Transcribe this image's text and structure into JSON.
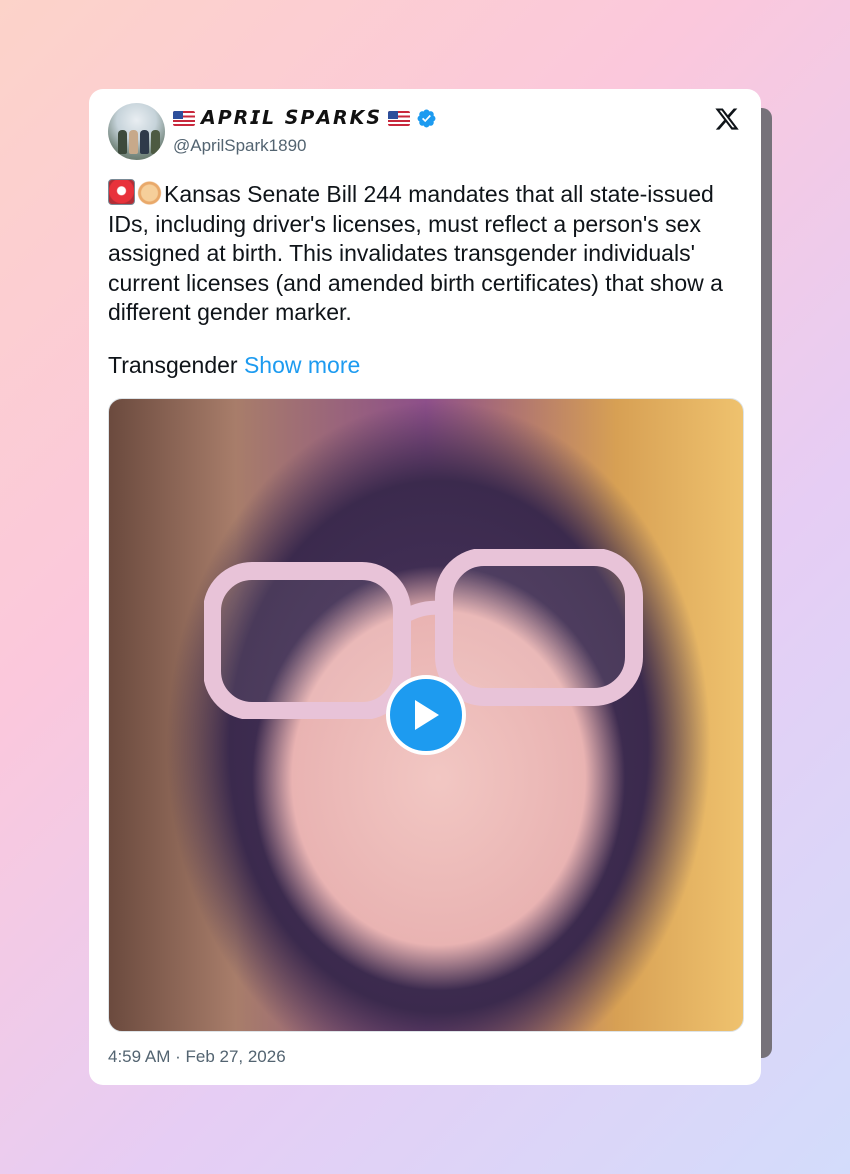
{
  "tweet": {
    "display_name": "𝘼𝙋𝙍𝙄𝙇 𝙎𝙋𝘼𝙍𝙆𝙎",
    "handle": "@AprilSpark1890",
    "text": "Kansas Senate Bill 244 mandates that all state-issued IDs, including driver's licenses, must reflect a person's sex assigned at birth. This invalidates transgender individuals' current licenses (and amended birth certificates) that show a different gender marker.",
    "second_paragraph": "Transgender ",
    "show_more_label": "Show more",
    "timestamp": "4:59 AM · Feb 27, 2026",
    "emojis": [
      "police-light-emoji",
      "clapping-hands-emoji"
    ]
  },
  "icons": {
    "platform": "x-logo-icon",
    "verified": "verified-badge-icon",
    "play": "play-icon",
    "flag": "us-flag-icon"
  },
  "colors": {
    "accent": "#1d9bf0",
    "text": "#0f1419",
    "secondary": "#536471"
  }
}
